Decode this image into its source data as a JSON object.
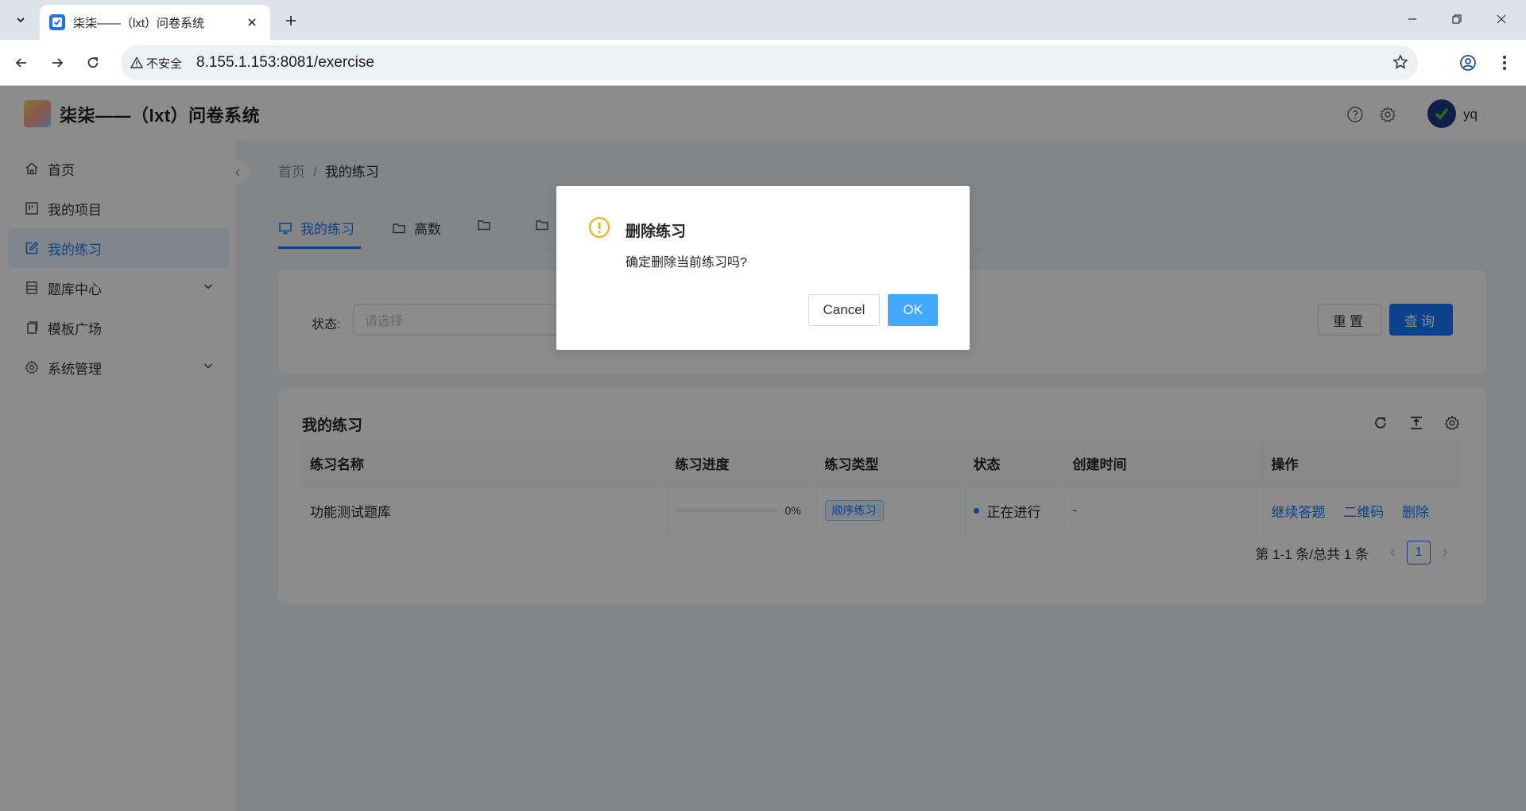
{
  "browser": {
    "tab_title": "柒柒——（lxt）问卷系统",
    "insecure_label": "不安全",
    "url": "8.155.1.153:8081/exercise"
  },
  "header": {
    "title": "柒柒——（lxt）问卷系统",
    "username": "yq"
  },
  "sidebar": {
    "items": [
      {
        "label": "首页",
        "icon": "home-icon"
      },
      {
        "label": "我的项目",
        "icon": "project-icon"
      },
      {
        "label": "我的练习",
        "icon": "edit-icon",
        "active": true
      },
      {
        "label": "题库中心",
        "icon": "database-icon",
        "expandable": true
      },
      {
        "label": "模板广场",
        "icon": "copy-icon"
      },
      {
        "label": "系统管理",
        "icon": "gear-icon",
        "expandable": true
      }
    ]
  },
  "breadcrumb": {
    "home": "首页",
    "separator": "/",
    "current": "我的练习"
  },
  "tabs": [
    {
      "label": "我的练习",
      "icon": "desktop-icon",
      "active": true
    },
    {
      "label": "高数",
      "icon": "folder-icon"
    },
    {
      "label": "",
      "icon": "folder-icon"
    },
    {
      "label": "",
      "icon": "folder-icon"
    }
  ],
  "filter": {
    "status_label": "状态:",
    "status_placeholder": "请选择",
    "reset_label": "重置",
    "query_label": "查询"
  },
  "table": {
    "title": "我的练习",
    "columns": [
      "练习名称",
      "练习进度",
      "练习类型",
      "状态",
      "创建时间",
      "操作"
    ],
    "rows": [
      {
        "name": "功能测试题库",
        "progress": 0,
        "progress_text": "0%",
        "type": "顺序练习",
        "status": "正在进行",
        "created": "-",
        "actions": [
          "继续答题",
          "二维码",
          "删除"
        ]
      }
    ]
  },
  "pagination": {
    "total_text": "第 1-1 条/总共 1 条",
    "current_page": "1"
  },
  "modal": {
    "title": "删除练习",
    "content": "确定删除当前练习吗?",
    "cancel_label": "Cancel",
    "ok_label": "OK"
  },
  "colors": {
    "primary": "#1677ff",
    "warning": "#faad14",
    "ok_button": "#40a9ff"
  }
}
